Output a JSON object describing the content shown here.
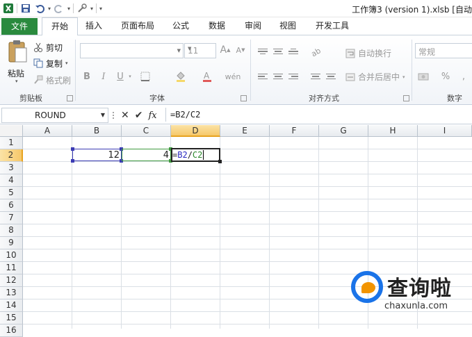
{
  "window": {
    "title": "工作簿3 (version 1).xlsb [自动"
  },
  "tabs": [
    "文件",
    "开始",
    "插入",
    "页面布局",
    "公式",
    "数据",
    "审阅",
    "视图",
    "开发工具"
  ],
  "ribbon": {
    "clipboard": {
      "paste": "粘贴",
      "cut": "剪切",
      "copy": "复制",
      "format_painter": "格式刷",
      "title": "剪贴板"
    },
    "font": {
      "name": "",
      "size": "11",
      "bold": "B",
      "italic": "I",
      "underline": "U",
      "grow": "A",
      "shrink": "A",
      "phonetic": "wén",
      "title": "字体"
    },
    "alignment": {
      "wrap": "自动换行",
      "merge": "合并后居中",
      "title": "对齐方式"
    },
    "number": {
      "format": "常规",
      "percent": "%",
      "comma": ",",
      "title": "数字"
    }
  },
  "formula_bar": {
    "name_box": "ROUND",
    "fx": "fx",
    "formula": "=B2/C2"
  },
  "sheet": {
    "columns": [
      "A",
      "B",
      "C",
      "D",
      "E",
      "F",
      "G",
      "H",
      "I"
    ],
    "rows": [
      "1",
      "2",
      "3",
      "4",
      "5",
      "6",
      "7",
      "8",
      "9",
      "10",
      "11",
      "12",
      "13",
      "14",
      "15",
      "16"
    ],
    "selected_column": "D",
    "selected_row": "2",
    "cells": {
      "B2": "12",
      "C2": "4",
      "D2_ref_b": "B2",
      "D2_slash": "/",
      "D2_ref_c": "C2",
      "D2_eq": "="
    }
  },
  "watermark": {
    "brand": "查询啦",
    "url": "chaxunla.com"
  },
  "colors": {
    "file_tab": "#2a8a3e",
    "ref_b": "#3b3bb3",
    "ref_c": "#3f9a3f",
    "selected_header": "#f6c86a"
  }
}
